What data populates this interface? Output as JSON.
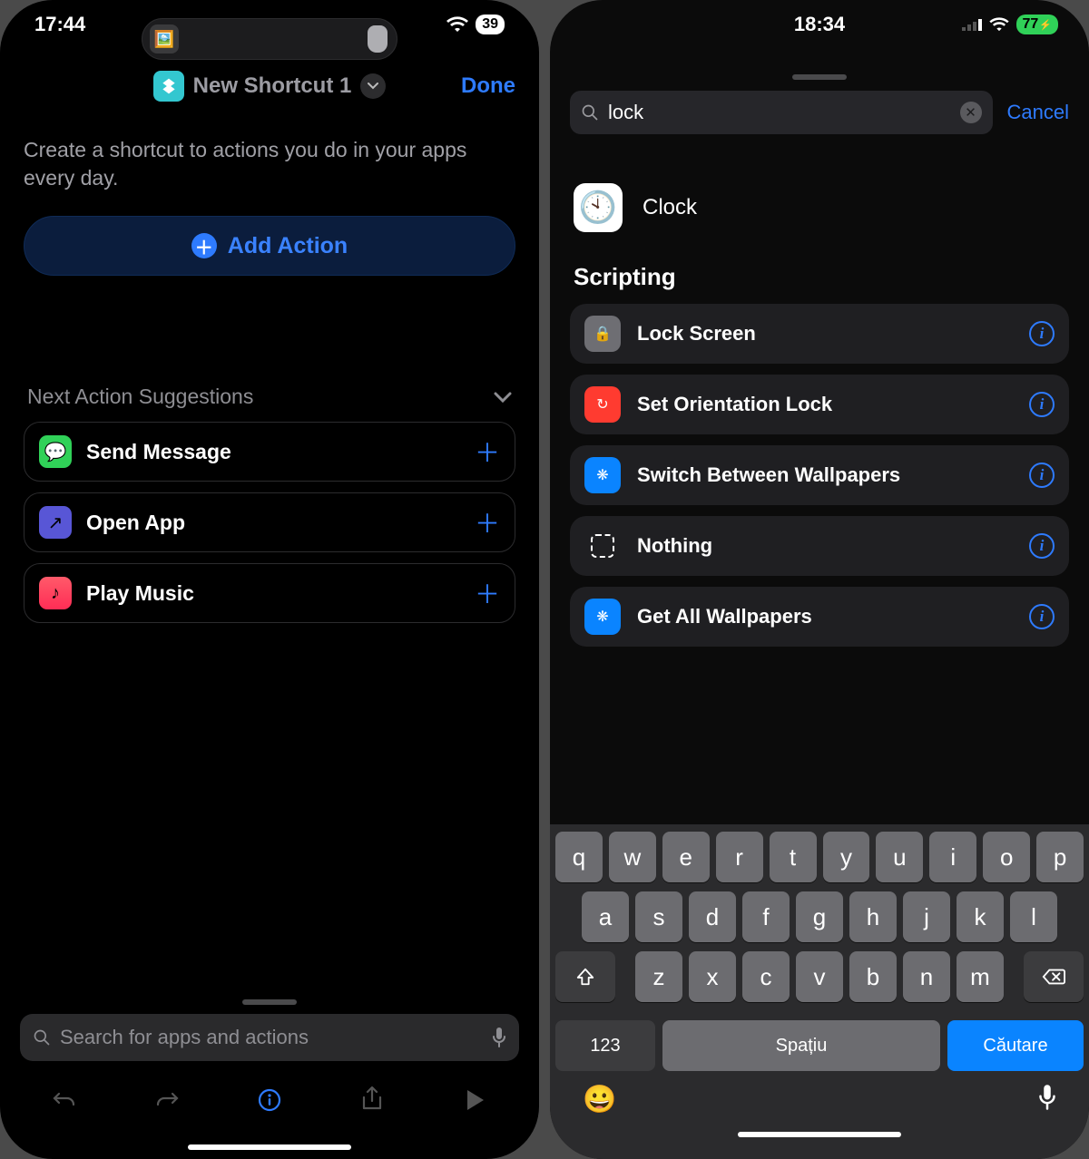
{
  "left": {
    "status": {
      "time": "17:44",
      "battery": "39"
    },
    "header": {
      "title": "New Shortcut 1",
      "done": "Done"
    },
    "intro": "Create a shortcut to actions you do in your apps every day.",
    "add_action": "Add Action",
    "suggestions_title": "Next Action Suggestions",
    "suggestions": [
      {
        "label": "Send Message",
        "icon": "messages"
      },
      {
        "label": "Open App",
        "icon": "open-app"
      },
      {
        "label": "Play Music",
        "icon": "music"
      }
    ],
    "search_placeholder": "Search for apps and actions"
  },
  "right": {
    "status": {
      "time": "18:34",
      "battery": "77"
    },
    "search": {
      "value": "lock",
      "cancel": "Cancel"
    },
    "app_result": {
      "label": "Clock"
    },
    "section": "Scripting",
    "actions": [
      {
        "label": "Lock Screen",
        "icon": "lock",
        "color": "grey"
      },
      {
        "label": "Set Orientation Lock",
        "icon": "rotate",
        "color": "red"
      },
      {
        "label": "Switch Between Wallpapers",
        "icon": "flower",
        "color": "blue"
      },
      {
        "label": "Nothing",
        "icon": "outline",
        "color": "out"
      },
      {
        "label": "Get All Wallpapers",
        "icon": "flower",
        "color": "blue"
      }
    ],
    "keyboard": {
      "row1": [
        "q",
        "w",
        "e",
        "r",
        "t",
        "y",
        "u",
        "i",
        "o",
        "p"
      ],
      "row2": [
        "a",
        "s",
        "d",
        "f",
        "g",
        "h",
        "j",
        "k",
        "l"
      ],
      "row3": [
        "z",
        "x",
        "c",
        "v",
        "b",
        "n",
        "m"
      ],
      "k123": "123",
      "space": "Spațiu",
      "search": "Căutare"
    }
  }
}
